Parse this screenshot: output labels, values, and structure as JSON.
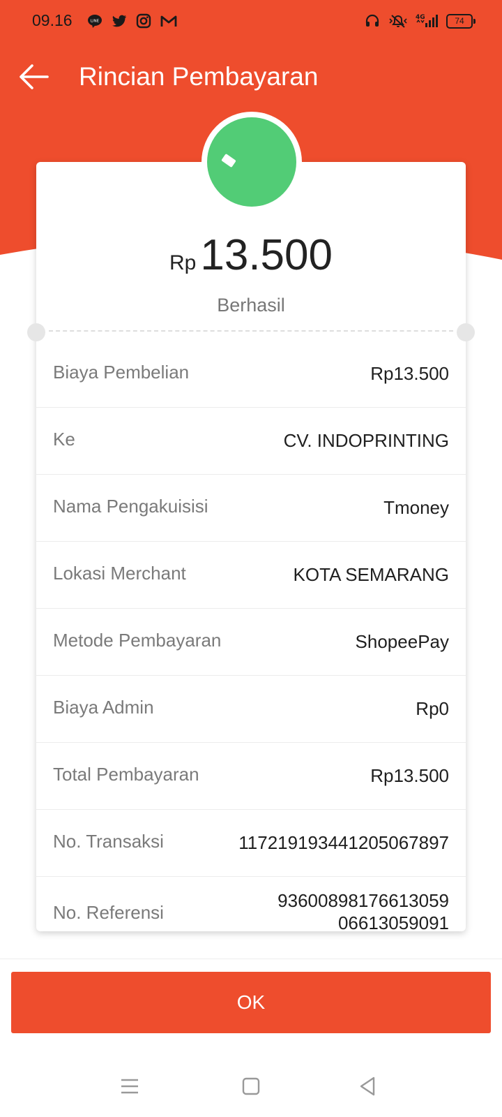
{
  "colors": {
    "accent": "#ee4d2d",
    "success": "#52cc76"
  },
  "status_bar": {
    "time": "09.16",
    "left_icons": [
      "line-icon",
      "twitter-icon",
      "instagram-icon",
      "gmail-icon"
    ],
    "right_icons": [
      "headset-icon",
      "mute-icon",
      "signal-4g-icon"
    ],
    "battery": "74"
  },
  "header": {
    "title": "Rincian Pembayaran"
  },
  "summary": {
    "currency": "Rp",
    "amount": "13.500",
    "status": "Berhasil"
  },
  "details": [
    {
      "label": "Biaya Pembelian",
      "value": "Rp13.500"
    },
    {
      "label": "Ke",
      "value": "CV. INDOPRINTING"
    },
    {
      "label": "Nama Pengakuisisi",
      "value": "Tmoney"
    },
    {
      "label": "Lokasi Merchant",
      "value": "KOTA SEMARANG"
    },
    {
      "label": "Metode Pembayaran",
      "value": "ShopeePay"
    },
    {
      "label": "Biaya Admin",
      "value": "Rp0"
    },
    {
      "label": "Total Pembayaran",
      "value": "Rp13.500"
    },
    {
      "label": "No. Transaksi",
      "value": "117219193441205067897"
    },
    {
      "label": "No. Referensi",
      "value": "9360089817661305906613059091"
    }
  ],
  "actions": {
    "ok_label": "OK"
  }
}
